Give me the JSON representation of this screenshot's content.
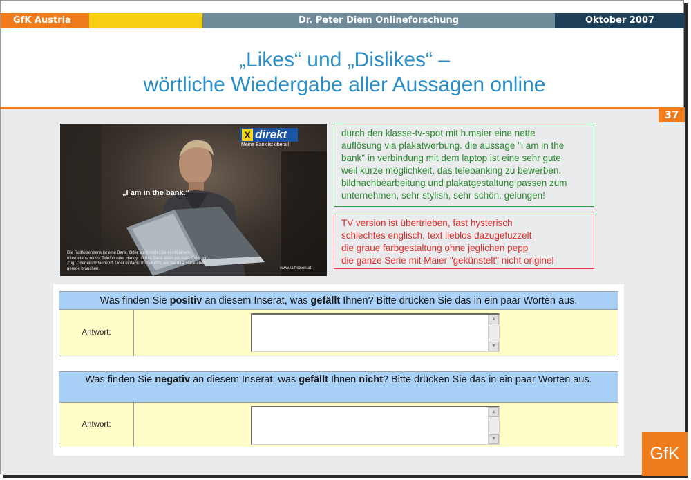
{
  "header": {
    "left": "GfK Austria",
    "center": "Dr. Peter Diem  Onlineforschung",
    "right": "Oktober 2007"
  },
  "title": {
    "line1": "„Likes“ und „Dislikes“ –",
    "line2": "wörtliche Wiedergabe aller Aussagen online"
  },
  "page_number": "37",
  "ad": {
    "logo": "direkt",
    "logo_x": "X",
    "slogan": "Meine Bank ist überall",
    "quote": "„I am in the bank.“",
    "fine_print": "Die Raiffeisenbank ist eine Bank. Oder auch mehr. Denn mit einem Internetanschluss, Telefon oder Handy, ist Ihre Bank dann ein Auto. Oder ein Zug. Oder ein Urlaubsort. Oder einfach: Immer dort, wo Sie eine Bank eben gerade brauchen.",
    "url": "www.raiffeisen.at"
  },
  "likes": [
    "durch den klasse-tv-spot mit h.maier eine nette",
    "auflösung via plakatwerbung. die aussage \"i am in the",
    "bank\" in verbindung mit dem laptop ist eine sehr gute",
    "weil kurze möglichkeit, das telebanking zu bewerben.",
    "bildnachbearbeitung und plakatgestaltung passen zum",
    "unternehmen, sehr stylish, sehr schön. gelungen!"
  ],
  "dislikes": [
    "TV version ist übertrieben, fast hysterisch",
    "schlechtes englisch, text lieblos dazugefuzzelt",
    "die graue farbgestaltung ohne jeglichen pepp",
    "die ganze Serie mit Maier \"gekünstelt\" nicht originel"
  ],
  "survey": {
    "q1": {
      "pre": "Was finden Sie ",
      "bold1": "positiv",
      "mid": " an diesem Inserat, was ",
      "bold2": "gefällt",
      "post": " Ihnen? Bitte drücken Sie das in ein paar Worten aus.",
      "label": "Antwort:",
      "value": ""
    },
    "q2": {
      "pre": "Was finden Sie ",
      "bold1": "negativ",
      "mid": " an diesem Inserat, was ",
      "bold2": "gefällt",
      "mid2": " Ihnen ",
      "bold3": "nicht",
      "post": "? Bitte drücken Sie das in ein paar Worten aus.",
      "label": "Antwort:",
      "value": ""
    }
  },
  "logo": "GfK",
  "colors": {
    "orange": "#f07c1c",
    "yellow": "#f9cf12",
    "slate": "#6f8b99",
    "navy": "#1e3f58",
    "title_blue": "#2a8fc9",
    "likes_green": "#2a8a2f",
    "dislikes_red": "#e12e2a",
    "question_blue": "#a9d1f7",
    "answer_yellow": "#fffdc8"
  }
}
